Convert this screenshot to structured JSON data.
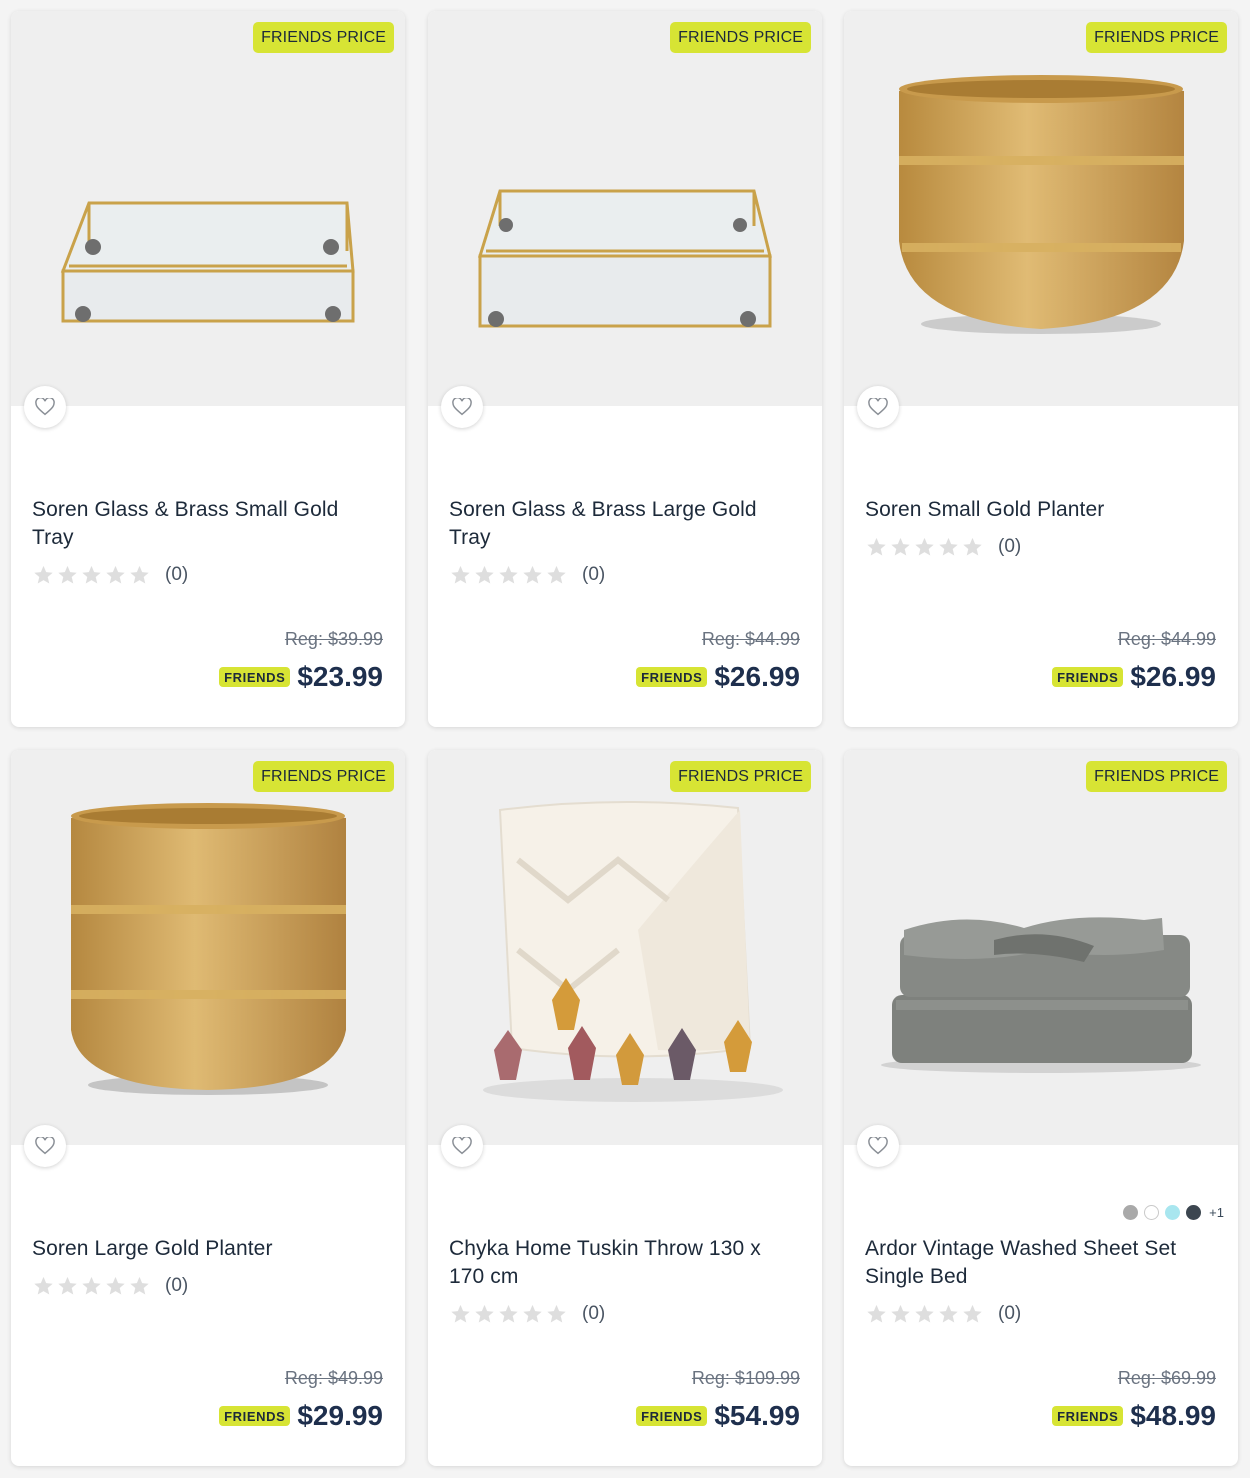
{
  "colors": {
    "promo": "#d7e434",
    "price": "#1e2f4d",
    "text": "#1d2a3a",
    "star_empty": "#dedede"
  },
  "products": [
    {
      "promo_label": "FRIENDS PRICE",
      "name": "Soren Glass & Brass Small Gold Tray",
      "rating_count": "(0)",
      "stars": 0,
      "reg_price": "Reg: $39.99",
      "friends_label": "FRIENDS",
      "price": "$23.99",
      "image_icon": "tray-small-image"
    },
    {
      "promo_label": "FRIENDS PRICE",
      "name": "Soren Glass & Brass Large Gold Tray",
      "rating_count": "(0)",
      "stars": 0,
      "reg_price": "Reg: $44.99",
      "friends_label": "FRIENDS",
      "price": "$26.99",
      "image_icon": "tray-large-image"
    },
    {
      "promo_label": "FRIENDS PRICE",
      "name": "Soren Small Gold Planter",
      "rating_count": "(0)",
      "stars": 0,
      "reg_price": "Reg: $44.99",
      "friends_label": "FRIENDS",
      "price": "$26.99",
      "image_icon": "planter-small-image"
    },
    {
      "promo_label": "FRIENDS PRICE",
      "name": "Soren Large Gold Planter",
      "rating_count": "(0)",
      "stars": 0,
      "reg_price": "Reg: $49.99",
      "friends_label": "FRIENDS",
      "price": "$29.99",
      "image_icon": "planter-large-image"
    },
    {
      "promo_label": "FRIENDS PRICE",
      "name": "Chyka Home Tuskin Throw 130 x 170 cm",
      "rating_count": "(0)",
      "stars": 0,
      "reg_price": "Reg: $109.99",
      "friends_label": "FRIENDS",
      "price": "$54.99",
      "image_icon": "throw-blanket-image"
    },
    {
      "promo_label": "FRIENDS PRICE",
      "name": "Ardor Vintage Washed Sheet Set Single Bed",
      "rating_count": "(0)",
      "stars": 0,
      "reg_price": "Reg: $69.99",
      "friends_label": "FRIENDS",
      "price": "$48.99",
      "image_icon": "sheet-set-image",
      "swatches": [
        "#a9a9a9",
        "#ffffff",
        "#a8e6ef",
        "#3c4650"
      ],
      "more_colors": "+1"
    }
  ]
}
